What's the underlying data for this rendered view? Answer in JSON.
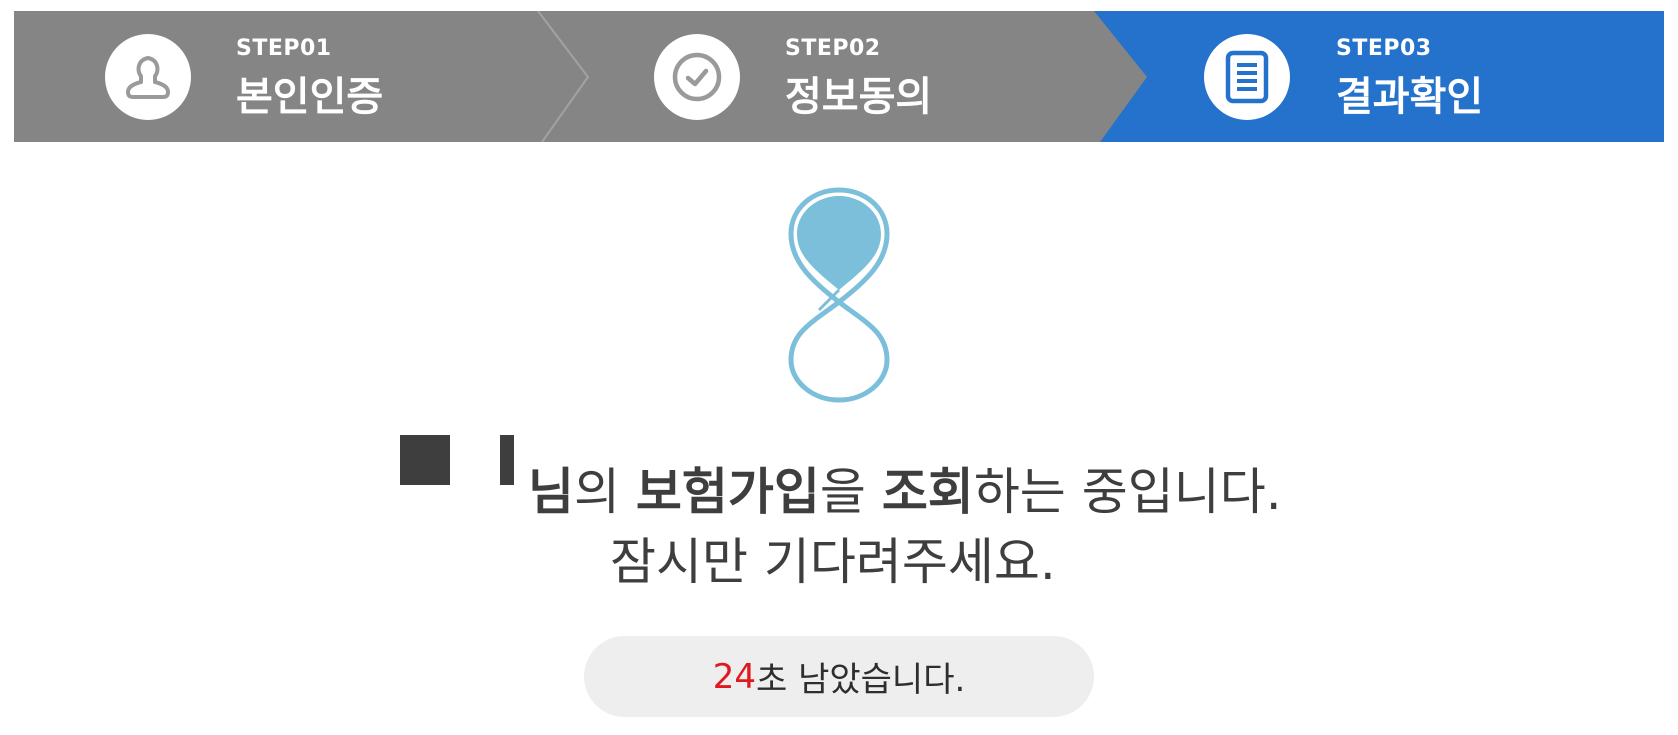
{
  "steps": [
    {
      "num": "STEP01",
      "title": "본인인증",
      "icon": "user-icon",
      "state": "done"
    },
    {
      "num": "STEP02",
      "title": "정보동의",
      "icon": "check-circle-icon",
      "state": "done"
    },
    {
      "num": "STEP03",
      "title": "결과확인",
      "icon": "document-icon",
      "state": "active"
    }
  ],
  "colors": {
    "inactive_step": "#858585",
    "active_step": "#2472cc",
    "loader": "#7bbfda",
    "countdown": "#e0191f"
  },
  "message": {
    "name_suffix": "님",
    "part1": "의 ",
    "insurance": "보험가입",
    "part2": "을 ",
    "inquiry": "조회",
    "part3": "하는 중입니다.",
    "line2": "잠시만 기다려주세요."
  },
  "timer": {
    "seconds": "24",
    "suffix": "초 남았습니다."
  }
}
